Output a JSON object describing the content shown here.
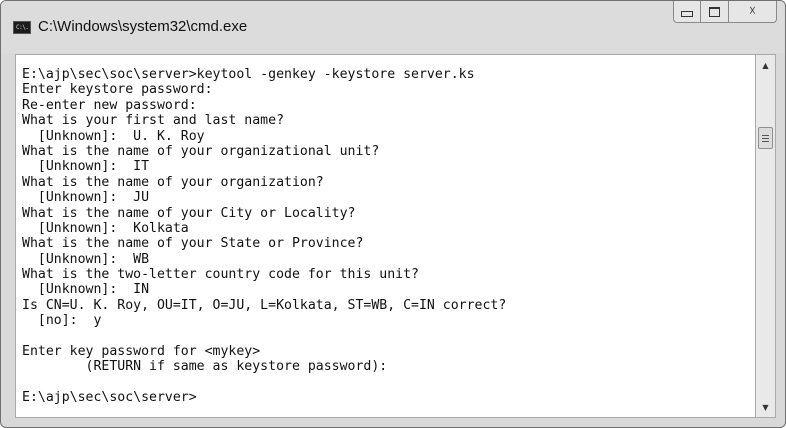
{
  "window": {
    "title": "C:\\Windows\\system32\\cmd.exe",
    "icon": "cmd-icon",
    "icon_text": "C:\\."
  },
  "controls": {
    "minimize_icon": "minimize-icon",
    "maximize_icon": "maximize-icon",
    "close_glyph": "☓"
  },
  "console": {
    "lines": [
      "E:\\ajp\\sec\\soc\\server>keytool -genkey -keystore server.ks",
      "Enter keystore password:",
      "Re-enter new password:",
      "What is your first and last name?",
      "  [Unknown]:  U. K. Roy",
      "What is the name of your organizational unit?",
      "  [Unknown]:  IT",
      "What is the name of your organization?",
      "  [Unknown]:  JU",
      "What is the name of your City or Locality?",
      "  [Unknown]:  Kolkata",
      "What is the name of your State or Province?",
      "  [Unknown]:  WB",
      "What is the two-letter country code for this unit?",
      "  [Unknown]:  IN",
      "Is CN=U. K. Roy, OU=IT, O=JU, L=Kolkata, ST=WB, C=IN correct?",
      "  [no]:  y",
      "",
      "Enter key password for <mykey>",
      "        (RETURN if same as keystore password):",
      "",
      "E:\\ajp\\sec\\soc\\server>"
    ]
  },
  "scrollbar": {
    "up_glyph": "▲",
    "down_glyph": "▼"
  }
}
